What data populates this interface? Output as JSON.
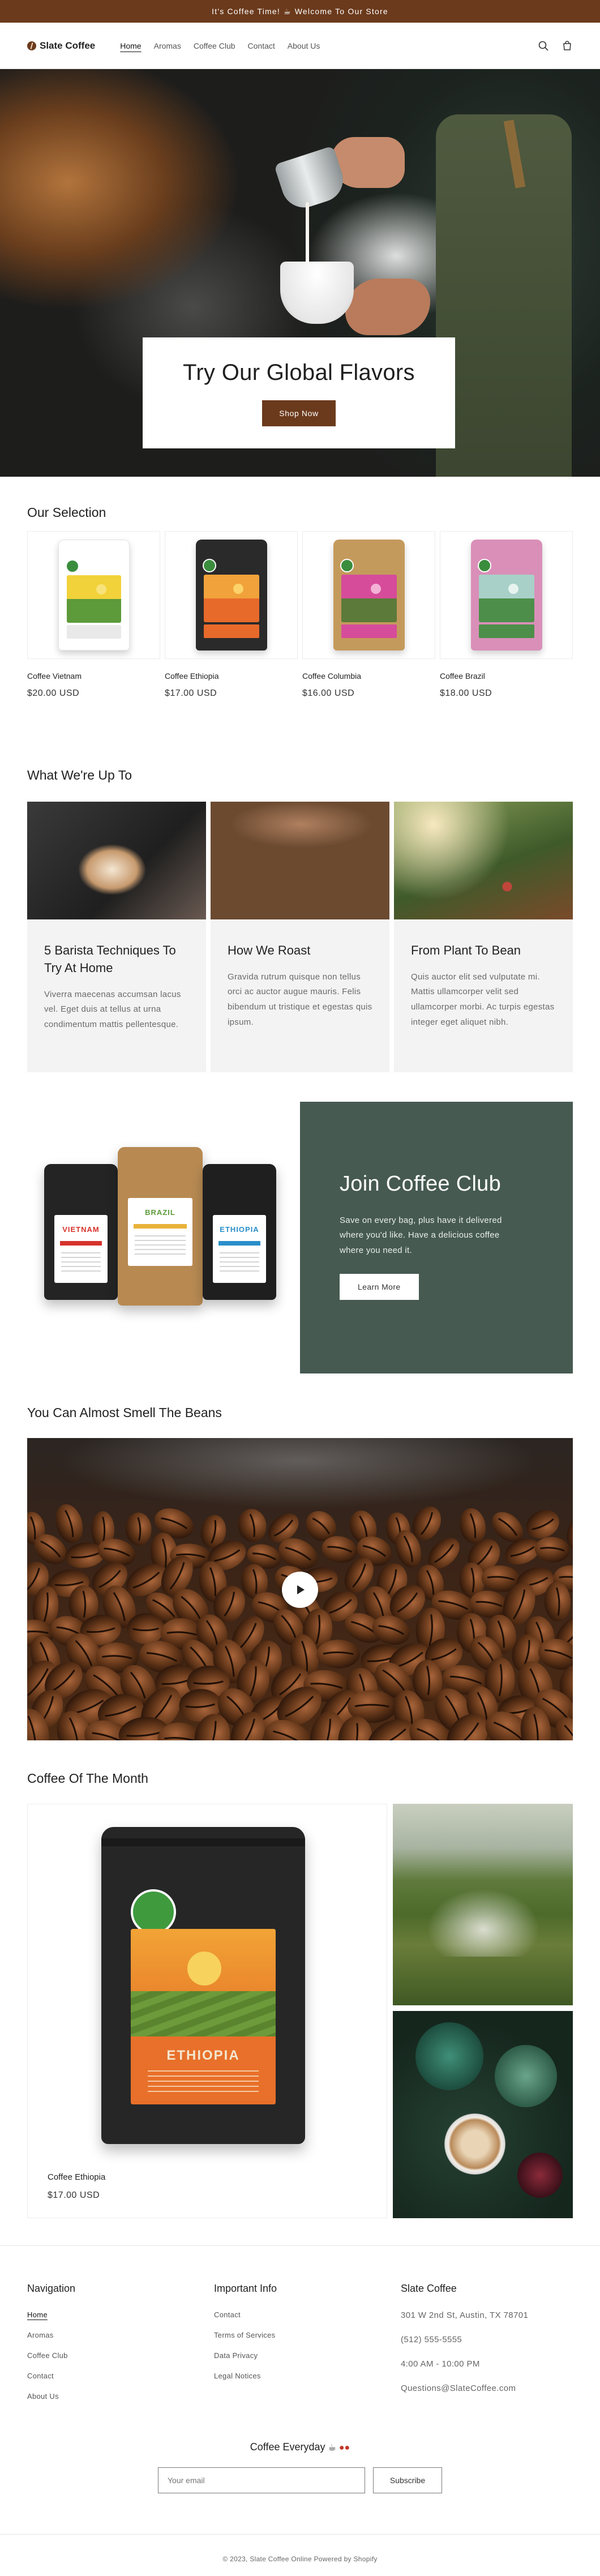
{
  "announcement": {
    "text": "It's Coffee Time!",
    "icon": "coffee-cup-icon",
    "text2": "Welcome To Our Store"
  },
  "header": {
    "logo": "Slate Coffee",
    "nav": [
      "Home",
      "Aromas",
      "Coffee Club",
      "Contact",
      "About Us"
    ],
    "active_nav": "Home",
    "icons": [
      "search-icon",
      "cart-icon"
    ]
  },
  "hero": {
    "title": "Try Our Global Flavors",
    "button": "Shop Now"
  },
  "selection": {
    "title": "Our Selection",
    "products": [
      {
        "name": "Coffee Vietnam",
        "price": "$20.00 USD",
        "bag_color": "#ffffff",
        "label_sky": "#f2d23a",
        "label_hills": "#5c9a3a"
      },
      {
        "name": "Coffee Ethiopia",
        "price": "$17.00 USD",
        "bag_color": "#2a2a2a",
        "label_sky": "#f1a23a",
        "label_hills": "#e86a2a"
      },
      {
        "name": "Coffee Columbia",
        "price": "$16.00 USD",
        "bag_color": "#c49a5c",
        "label_sky": "#d64c9a",
        "label_hills": "#5c7a3a"
      },
      {
        "name": "Coffee Brazil",
        "price": "$18.00 USD",
        "bag_color": "#d98fb8",
        "label_sky": "#a8d0c8",
        "label_hills": "#4d8f4a"
      }
    ]
  },
  "blog": {
    "title": "What We're Up To",
    "posts": [
      {
        "title": "5 Barista Techniques To Try At Home",
        "excerpt": "Viverra maecenas accumsan lacus vel. Eget duis at tellus at urna condimentum mattis pellentesque."
      },
      {
        "title": "How We Roast",
        "excerpt": "Gravida rutrum quisque non tellus orci ac auctor augue mauris. Felis bibendum ut tristique et egestas quis ipsum."
      },
      {
        "title": "From Plant To Bean",
        "excerpt": "Quis auctor elit sed vulputate mi. Mattis ullamcorper velit sed ullamcorper morbi. Ac turpis egestas integer eget aliquet nibh."
      }
    ]
  },
  "club": {
    "title": "Join Coffee Club",
    "text": "Save on every bag, plus have it delivered where you'd like. Have a delicious coffee where you need it.",
    "button": "Learn More",
    "bags": [
      "VIETNAM",
      "BRAZIL",
      "ETHIOPIA"
    ],
    "panel_color": "#465a52"
  },
  "video": {
    "title": "You Can Almost Smell The Beans",
    "icon": "play-icon"
  },
  "cotm": {
    "title": "Coffee Of The Month",
    "product_name": "Coffee Ethiopia",
    "price": "$17.00 USD",
    "bag_word": "ETHIOPIA"
  },
  "footer": {
    "col1": {
      "title": "Navigation",
      "links": [
        "Home",
        "Aromas",
        "Coffee Club",
        "Contact",
        "About Us"
      ]
    },
    "col2": {
      "title": "Important Info",
      "links": [
        "Contact",
        "Terms of Services",
        "Data Privacy",
        "Legal Notices"
      ]
    },
    "col3": {
      "title": "Slate Coffee",
      "lines": [
        "301 W 2nd St, Austin, TX 78701",
        "(512) 555-5555",
        "4:00 AM - 10:00 PM",
        "Questions@SlateCoffee.com"
      ]
    },
    "newsletter": {
      "title": "Coffee Everyday",
      "placeholder": "Your email",
      "button": "Subscribe"
    },
    "copyright": "© 2023, Slate Coffee Online Powered by Shopify"
  },
  "colors": {
    "brand_brown": "#6b3a1c",
    "club_green": "#465a52"
  }
}
